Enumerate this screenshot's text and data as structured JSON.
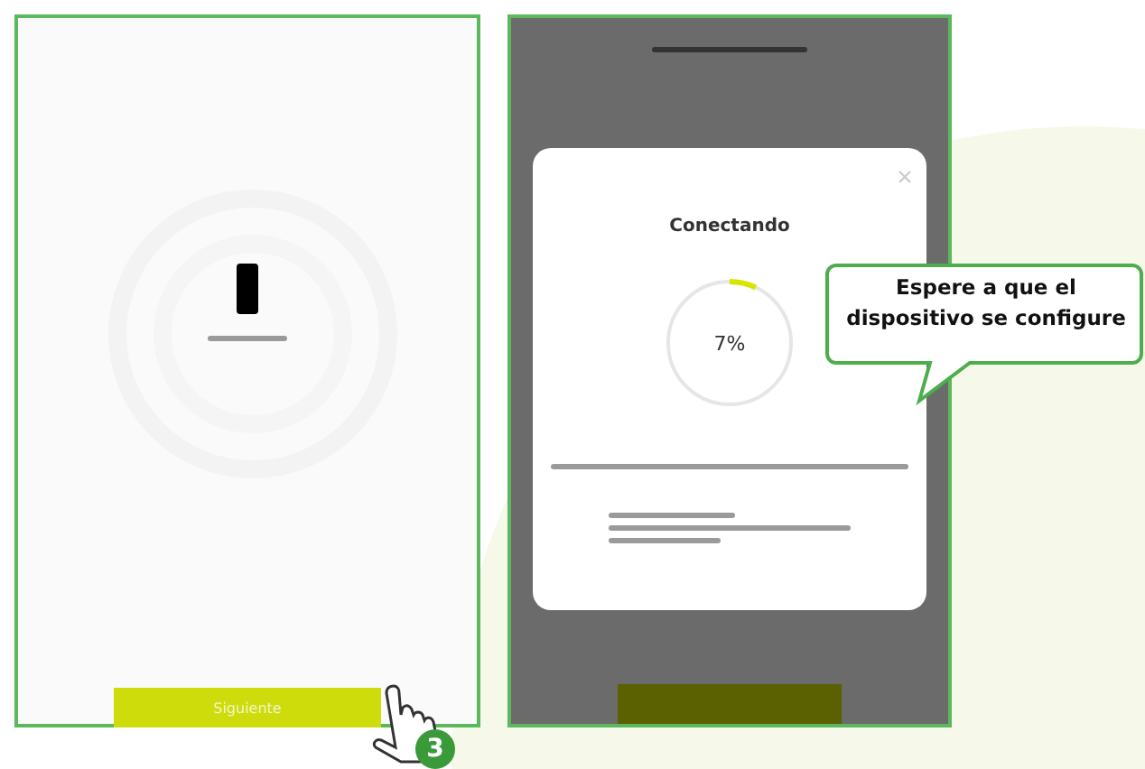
{
  "left_screen": {
    "button": {
      "label": "Siguiente"
    }
  },
  "right_screen": {
    "modal": {
      "title": "Conectando",
      "progress": {
        "level": 0.07,
        "reading": "7%"
      }
    }
  },
  "callout": {
    "text": "Espere a que el dispositivo se configure"
  },
  "step_badge": {
    "label": "3"
  }
}
